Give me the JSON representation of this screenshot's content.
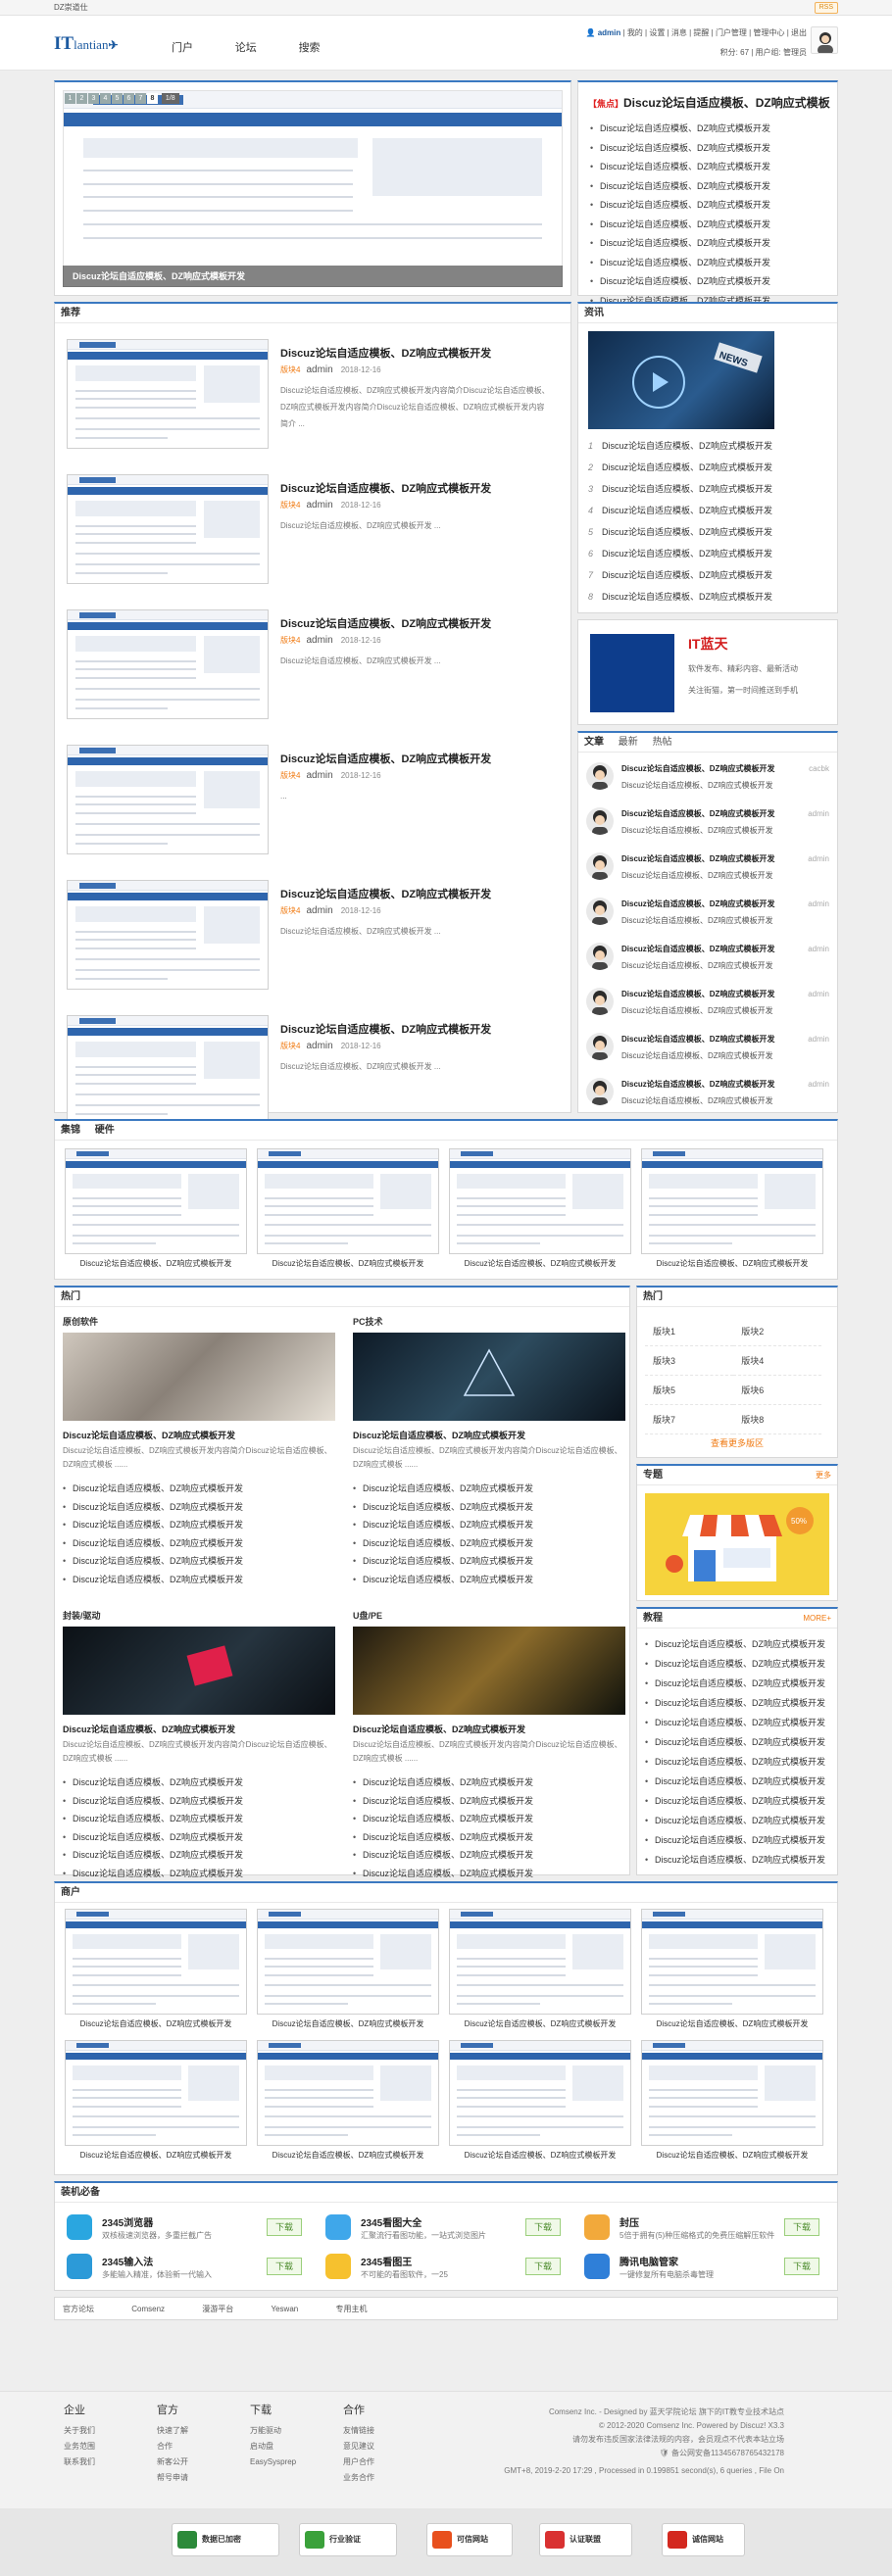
{
  "topbar": {
    "site_name": "DZ崇道仕",
    "rss": "RSS"
  },
  "header": {
    "logo_text": "IT",
    "logo_tail": "lantian",
    "nav": [
      "门户",
      "论坛",
      "搜索"
    ],
    "user": {
      "name": "admin",
      "links1": [
        "我的",
        "设置",
        "消息",
        "提醒",
        "门户管理",
        "管理中心",
        "退出"
      ],
      "credit": "积分: 67",
      "group": "用户组: 管理员"
    }
  },
  "slider": {
    "nums": [
      "1",
      "2",
      "3",
      "4",
      "5",
      "6",
      "7",
      "8"
    ],
    "active": "8",
    "counter": "1/8",
    "caption": "Discuz论坛自适应模板、DZ响应式模板开发"
  },
  "hot_news": {
    "tag": "【焦点】",
    "title": "Discuz论坛自适应模板、DZ响应式模板",
    "items": [
      "Discuz论坛自适应模板、DZ响应式模板开发",
      "Discuz论坛自适应模板、DZ响应式模板开发",
      "Discuz论坛自适应模板、DZ响应式模板开发",
      "Discuz论坛自适应模板、DZ响应式模板开发",
      "Discuz论坛自适应模板、DZ响应式模板开发",
      "Discuz论坛自适应模板、DZ响应式模板开发",
      "Discuz论坛自适应模板、DZ响应式模板开发",
      "Discuz论坛自适应模板、DZ响应式模板开发",
      "Discuz论坛自适应模板、DZ响应式模板开发",
      "Discuz论坛自适应模板、DZ响应式模板开发"
    ]
  },
  "recommend": {
    "title": "推荐",
    "items": [
      {
        "title": "Discuz论坛自适应模板、DZ响应式模板开发",
        "cat": "版块4",
        "author": "admin",
        "date": "2018-12-16",
        "desc": "Discuz论坛自适应模板、DZ响应式模板开发内容简介Discuz论坛自适应模板、DZ响应式模板开发内容简介Discuz论坛自适应模板、DZ响应式模板开发内容简介 ..."
      },
      {
        "title": "Discuz论坛自适应模板、DZ响应式模板开发",
        "cat": "版块4",
        "author": "admin",
        "date": "2018-12-16",
        "desc": "Discuz论坛自适应模板、DZ响应式模板开发 ..."
      },
      {
        "title": "Discuz论坛自适应模板、DZ响应式模板开发",
        "cat": "版块4",
        "author": "admin",
        "date": "2018-12-16",
        "desc": "Discuz论坛自适应模板、DZ响应式模板开发 ..."
      },
      {
        "title": "Discuz论坛自适应模板、DZ响应式模板开发",
        "cat": "版块4",
        "author": "admin",
        "date": "2018-12-16",
        "desc": "..."
      },
      {
        "title": "Discuz论坛自适应模板、DZ响应式模板开发",
        "cat": "版块4",
        "author": "admin",
        "date": "2018-12-16",
        "desc": "Discuz论坛自适应模板、DZ响应式模板开发 ..."
      },
      {
        "title": "Discuz论坛自适应模板、DZ响应式模板开发",
        "cat": "版块4",
        "author": "admin",
        "date": "2018-12-16",
        "desc": "Discuz论坛自适应模板、DZ响应式模板开发 ..."
      }
    ]
  },
  "news": {
    "title": "资讯",
    "image_label": "NEWS",
    "items": [
      "Discuz论坛自适应模板、DZ响应式模板开发",
      "Discuz论坛自适应模板、DZ响应式模板开发",
      "Discuz论坛自适应模板、DZ响应式模板开发",
      "Discuz论坛自适应模板、DZ响应式模板开发",
      "Discuz论坛自适应模板、DZ响应式模板开发",
      "Discuz论坛自适应模板、DZ响应式模板开发",
      "Discuz论坛自适应模板、DZ响应式模板开发",
      "Discuz论坛自适应模板、DZ响应式模板开发"
    ]
  },
  "promo": {
    "title": "IT蓝天",
    "line1": "软件发布、精彩内容、最新活动",
    "line2": "关注街猫，第一时间推送到手机"
  },
  "articles": {
    "tabs": [
      "文章",
      "最新",
      "热帖"
    ],
    "items": [
      {
        "t": "Discuz论坛自适应模板、DZ响应式模板开发",
        "s": "Discuz论坛自适应模板、DZ响应式模板开发",
        "a": "cacbk"
      },
      {
        "t": "Discuz论坛自适应模板、DZ响应式模板开发",
        "s": "Discuz论坛自适应模板、DZ响应式模板开发",
        "a": "admin"
      },
      {
        "t": "Discuz论坛自适应模板、DZ响应式模板开发",
        "s": "Discuz论坛自适应模板、DZ响应式模板开发",
        "a": "admin"
      },
      {
        "t": "Discuz论坛自适应模板、DZ响应式模板开发",
        "s": "Discuz论坛自适应模板、DZ响应式模板开发",
        "a": "admin"
      },
      {
        "t": "Discuz论坛自适应模板、DZ响应式模板开发",
        "s": "Discuz论坛自适应模板、DZ响应式模板开发",
        "a": "admin"
      },
      {
        "t": "Discuz论坛自适应模板、DZ响应式模板开发",
        "s": "Discuz论坛自适应模板、DZ响应式模板开发",
        "a": "admin"
      },
      {
        "t": "Discuz论坛自适应模板、DZ响应式模板开发",
        "s": "Discuz论坛自适应模板、DZ响应式模板开发",
        "a": "admin"
      },
      {
        "t": "Discuz论坛自适应模板、DZ响应式模板开发",
        "s": "Discuz论坛自适应模板、DZ响应式模板开发",
        "a": "admin"
      }
    ]
  },
  "collection": {
    "tabs": [
      "集锦",
      "硬件"
    ],
    "captions": [
      "Discuz论坛自适应模板、DZ响应式模板开发",
      "Discuz论坛自适应模板、DZ响应式模板开发",
      "Discuz论坛自适应模板、DZ响应式模板开发",
      "Discuz论坛自适应模板、DZ响应式模板开发"
    ]
  },
  "hot": {
    "title": "热门",
    "blocks": [
      {
        "sub": "原创软件",
        "title": "Discuz论坛自适应模板、DZ响应式模板开发",
        "desc": "Discuz论坛自适应模板、DZ响应式模板开发内容简介Discuz论坛自适应模板、DZ响应式模板 ......",
        "items": [
          "Discuz论坛自适应模板、DZ响应式模板开发",
          "Discuz论坛自适应模板、DZ响应式模板开发",
          "Discuz论坛自适应模板、DZ响应式模板开发",
          "Discuz论坛自适应模板、DZ响应式模板开发",
          "Discuz论坛自适应模板、DZ响应式模板开发",
          "Discuz论坛自适应模板、DZ响应式模板开发"
        ]
      },
      {
        "sub": "PC技术",
        "title": "Discuz论坛自适应模板、DZ响应式模板开发",
        "desc": "Discuz论坛自适应模板、DZ响应式模板开发内容简介Discuz论坛自适应模板、DZ响应式模板 ......",
        "items": [
          "Discuz论坛自适应模板、DZ响应式模板开发",
          "Discuz论坛自适应模板、DZ响应式模板开发",
          "Discuz论坛自适应模板、DZ响应式模板开发",
          "Discuz论坛自适应模板、DZ响应式模板开发",
          "Discuz论坛自适应模板、DZ响应式模板开发",
          "Discuz论坛自适应模板、DZ响应式模板开发"
        ]
      },
      {
        "sub": "封装/驱动",
        "title": "Discuz论坛自适应模板、DZ响应式模板开发",
        "desc": "Discuz论坛自适应模板、DZ响应式模板开发内容简介Discuz论坛自适应模板、DZ响应式模板 ......",
        "items": [
          "Discuz论坛自适应模板、DZ响应式模板开发",
          "Discuz论坛自适应模板、DZ响应式模板开发",
          "Discuz论坛自适应模板、DZ响应式模板开发",
          "Discuz论坛自适应模板、DZ响应式模板开发",
          "Discuz论坛自适应模板、DZ响应式模板开发",
          "Discuz论坛自适应模板、DZ响应式模板开发"
        ]
      },
      {
        "sub": "U盘/PE",
        "title": "Discuz论坛自适应模板、DZ响应式模板开发",
        "desc": "Discuz论坛自适应模板、DZ响应式模板开发内容简介Discuz论坛自适应模板、DZ响应式模板 ......",
        "items": [
          "Discuz论坛自适应模板、DZ响应式模板开发",
          "Discuz论坛自适应模板、DZ响应式模板开发",
          "Discuz论坛自适应模板、DZ响应式模板开发",
          "Discuz论坛自适应模板、DZ响应式模板开发",
          "Discuz论坛自适应模板、DZ响应式模板开发",
          "Discuz论坛自适应模板、DZ响应式模板开发"
        ]
      }
    ]
  },
  "hot_side": {
    "title": "热门",
    "forums": [
      "版块1",
      "版块2",
      "版块3",
      "版块4",
      "版块5",
      "版块6",
      "版块7",
      "版块8"
    ],
    "more": "查看更多版区"
  },
  "special": {
    "title": "专题",
    "more": "更多",
    "badge": "50%"
  },
  "tutorial": {
    "title": "教程",
    "more": "MORE+",
    "items": [
      "Discuz论坛自适应模板、DZ响应式模板开发",
      "Discuz论坛自适应模板、DZ响应式模板开发",
      "Discuz论坛自适应模板、DZ响应式模板开发",
      "Discuz论坛自适应模板、DZ响应式模板开发",
      "Discuz论坛自适应模板、DZ响应式模板开发",
      "Discuz论坛自适应模板、DZ响应式模板开发",
      "Discuz论坛自适应模板、DZ响应式模板开发",
      "Discuz论坛自适应模板、DZ响应式模板开发",
      "Discuz论坛自适应模板、DZ响应式模板开发",
      "Discuz论坛自适应模板、DZ响应式模板开发",
      "Discuz论坛自适应模板、DZ响应式模板开发",
      "Discuz论坛自适应模板、DZ响应式模板开发"
    ]
  },
  "shop": {
    "title": "商户",
    "captions": [
      "Discuz论坛自适应模板、DZ响应式模板开发",
      "Discuz论坛自适应模板、DZ响应式模板开发",
      "Discuz论坛自适应模板、DZ响应式模板开发",
      "Discuz论坛自适应模板、DZ响应式模板开发",
      "Discuz论坛自适应模板、DZ响应式模板开发",
      "Discuz论坛自适应模板、DZ响应式模板开发",
      "Discuz论坛自适应模板、DZ响应式模板开发",
      "Discuz论坛自适应模板、DZ响应式模板开发"
    ]
  },
  "install": {
    "title": "装机必备",
    "button": "下载",
    "items": [
      {
        "name": "2345浏览器",
        "desc": "双核极速浏览器，多重拦截广告",
        "color": "#2aa6e0"
      },
      {
        "name": "2345看图大全",
        "desc": "汇聚流行看图功能，一站式浏览图片",
        "color": "#3fa7ea"
      },
      {
        "name": "封压",
        "desc": "5倍于拥有(5)种压缩格式的免费压缩解压软件",
        "color": "#f2a93b"
      },
      {
        "name": "2345输入法",
        "desc": "多能输入精准，体验新一代输入",
        "color": "#2c9ad8"
      },
      {
        "name": "2345看图王",
        "desc": "不可能的看图软件，一25",
        "color": "#f6c12e"
      },
      {
        "name": "腾讯电脑管家",
        "desc": "一键修复所有电脑杀毒管理",
        "color": "#2f7fd8"
      }
    ]
  },
  "friend_links": [
    "官方论坛",
    "Comsenz",
    "漫游平台",
    "Yeswan",
    "专用主机"
  ],
  "footer": {
    "cols": [
      {
        "h": "企业",
        "items": [
          "关于我们",
          "业务范围",
          "联系我们"
        ]
      },
      {
        "h": "官方",
        "items": [
          "快速了解",
          "合作",
          "新客公开",
          "帮号申请"
        ]
      },
      {
        "h": "下载",
        "items": [
          "万能驱动",
          "启动盘",
          "EasySysprep"
        ]
      },
      {
        "h": "合作",
        "items": [
          "友情链接",
          "意见建议",
          "用户合作",
          "业务合作"
        ]
      }
    ],
    "line1": "Comsenz Inc.  - Designed by 蓝天学院论坛 旗下的IT教专业技术站点",
    "line2": "© 2012-2020 Comsenz Inc.  Powered by Discuz! X3.3",
    "line3": "请勿发布违反国家法律法规的内容，会员观点不代表本站立场",
    "line4": "备公网安备11345678765432178",
    "line5": "GMT+8, 2019-2-20 17:29 , Processed in 0.199851 second(s), 6 queries , File On"
  },
  "badges": [
    {
      "label": "数据已加密",
      "color": "#2c8a3a"
    },
    {
      "label": "行业验证",
      "color": "#3aa13a"
    },
    {
      "label": "可信网站",
      "color": "#e8501d"
    },
    {
      "label": "认证联盟",
      "color": "#d93131"
    },
    {
      "label": "诚信网站",
      "color": "#d3281f"
    }
  ]
}
